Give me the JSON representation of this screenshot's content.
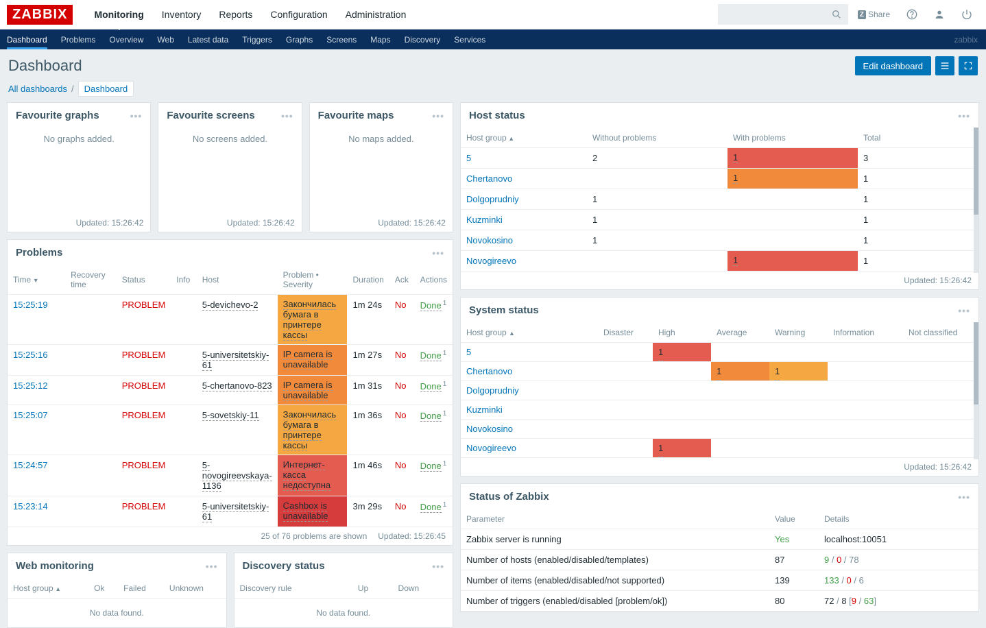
{
  "app": {
    "name": "ZABBIX",
    "user": "zabbix"
  },
  "topnav": [
    "Monitoring",
    "Inventory",
    "Reports",
    "Configuration",
    "Administration"
  ],
  "topnav_active": 0,
  "share": "Share",
  "subnav": [
    "Dashboard",
    "Problems",
    "Overview",
    "Web",
    "Latest data",
    "Triggers",
    "Graphs",
    "Screens",
    "Maps",
    "Discovery",
    "Services"
  ],
  "subnav_active": 0,
  "page": {
    "title": "Dashboard",
    "edit": "Edit dashboard"
  },
  "crumbs": {
    "all": "All dashboards",
    "sep": "/",
    "current": "Dashboard"
  },
  "fav": [
    {
      "title": "Favourite graphs",
      "empty": "No graphs added.",
      "updated": "Updated: 15:26:42"
    },
    {
      "title": "Favourite screens",
      "empty": "No screens added.",
      "updated": "Updated: 15:26:42"
    },
    {
      "title": "Favourite maps",
      "empty": "No maps added.",
      "updated": "Updated: 15:26:42"
    }
  ],
  "problems": {
    "title": "Problems",
    "cols": [
      "Time",
      "Recovery time",
      "Status",
      "Info",
      "Host",
      "Problem • Severity",
      "Duration",
      "Ack",
      "Actions"
    ],
    "rows": [
      {
        "time": "15:25:19",
        "status": "PROBLEM",
        "host": "5-devichevo-2",
        "problem": "Закончилась бумага в принтере кассы",
        "sev": "warn",
        "dur": "1m 24s",
        "ack": "No",
        "act": "Done",
        "sup": "1"
      },
      {
        "time": "15:25:16",
        "status": "PROBLEM",
        "host": "5-universitetskiy-61",
        "problem": "IP camera is unavailable",
        "sev": "avg",
        "dur": "1m 27s",
        "ack": "No",
        "act": "Done",
        "sup": "1"
      },
      {
        "time": "15:25:12",
        "status": "PROBLEM",
        "host": "5-chertanovo-823",
        "problem": "IP camera is unavailable",
        "sev": "avg",
        "dur": "1m 31s",
        "ack": "No",
        "act": "Done",
        "sup": "1"
      },
      {
        "time": "15:25:07",
        "status": "PROBLEM",
        "host": "5-sovetskiy-11",
        "problem": "Закончилась бумага в принтере кассы",
        "sev": "warn",
        "dur": "1m 36s",
        "ack": "No",
        "act": "Done",
        "sup": "1"
      },
      {
        "time": "15:24:57",
        "status": "PROBLEM",
        "host": "5-novogireevskaya-1136",
        "problem": "Интернет-касса недоступна",
        "sev": "high",
        "dur": "1m 46s",
        "ack": "No",
        "act": "Done",
        "sup": "1"
      },
      {
        "time": "15:23:14",
        "status": "PROBLEM",
        "host": "5-universitetskiy-61",
        "problem": "Cashbox is unavailable",
        "sev": "dis",
        "dur": "3m 29s",
        "ack": "No",
        "act": "Done",
        "sup": "1"
      }
    ],
    "summary": "25 of 76 problems are shown",
    "updated": "Updated: 15:26:45"
  },
  "web": {
    "title": "Web monitoring",
    "cols": [
      "Host group",
      "Ok",
      "Failed",
      "Unknown"
    ],
    "nodata": "No data found."
  },
  "discovery": {
    "title": "Discovery status",
    "cols": [
      "Discovery rule",
      "Up",
      "Down"
    ],
    "nodata": "No data found."
  },
  "hoststatus": {
    "title": "Host status",
    "cols": [
      "Host group",
      "Without problems",
      "With problems",
      "Total"
    ],
    "rows": [
      {
        "g": "5",
        "wo": "2",
        "wp": "1",
        "sev": "high",
        "tot": "3"
      },
      {
        "g": "Chertanovo",
        "wo": "",
        "wp": "1",
        "sev": "avg",
        "tot": "1"
      },
      {
        "g": "Dolgoprudniy",
        "wo": "1",
        "wp": "",
        "sev": "",
        "tot": "1"
      },
      {
        "g": "Kuzminki",
        "wo": "1",
        "wp": "",
        "sev": "",
        "tot": "1"
      },
      {
        "g": "Novokosino",
        "wo": "1",
        "wp": "",
        "sev": "",
        "tot": "1"
      },
      {
        "g": "Novogireevo",
        "wo": "",
        "wp": "1",
        "sev": "high",
        "tot": "1"
      }
    ],
    "updated": "Updated: 15:26:42"
  },
  "systemstatus": {
    "title": "System status",
    "cols": [
      "Host group",
      "Disaster",
      "High",
      "Average",
      "Warning",
      "Information",
      "Not classified"
    ],
    "rows": [
      {
        "g": "5",
        "dis": "",
        "high": "1",
        "avg": "",
        "warn": "",
        "info": "",
        "nc": ""
      },
      {
        "g": "Chertanovo",
        "dis": "",
        "high": "",
        "avg": "1",
        "warn": "1",
        "info": "",
        "nc": ""
      },
      {
        "g": "Dolgoprudniy",
        "dis": "",
        "high": "",
        "avg": "",
        "warn": "",
        "info": "",
        "nc": ""
      },
      {
        "g": "Kuzminki",
        "dis": "",
        "high": "",
        "avg": "",
        "warn": "",
        "info": "",
        "nc": ""
      },
      {
        "g": "Novokosino",
        "dis": "",
        "high": "",
        "avg": "",
        "warn": "",
        "info": "",
        "nc": ""
      },
      {
        "g": "Novogireevo",
        "dis": "",
        "high": "1",
        "avg": "",
        "warn": "",
        "info": "",
        "nc": ""
      }
    ],
    "updated": "Updated: 15:26:42"
  },
  "zstatus": {
    "title": "Status of Zabbix",
    "cols": [
      "Parameter",
      "Value",
      "Details"
    ],
    "rows": [
      {
        "p": "Zabbix server is running",
        "v": "Yes",
        "vclass": "green",
        "d": "localhost:10051"
      },
      {
        "p": "Number of hosts (enabled/disabled/templates)",
        "v": "87",
        "d_parts": [
          {
            "t": "9",
            "c": "green"
          },
          {
            "t": " / ",
            "c": "grey"
          },
          {
            "t": "0",
            "c": "red"
          },
          {
            "t": " / ",
            "c": "grey"
          },
          {
            "t": "78",
            "c": "grey"
          }
        ]
      },
      {
        "p": "Number of items (enabled/disabled/not supported)",
        "v": "139",
        "d_parts": [
          {
            "t": "133",
            "c": "green"
          },
          {
            "t": " / ",
            "c": "grey"
          },
          {
            "t": "0",
            "c": "red"
          },
          {
            "t": " / ",
            "c": "grey"
          },
          {
            "t": "6",
            "c": "grey"
          }
        ]
      },
      {
        "p": "Number of triggers (enabled/disabled [problem/ok])",
        "v": "80",
        "d_parts": [
          {
            "t": "72",
            "c": ""
          },
          {
            "t": " / ",
            "c": "grey"
          },
          {
            "t": "8",
            "c": ""
          },
          {
            "t": " [",
            "c": "grey"
          },
          {
            "t": "9",
            "c": "red"
          },
          {
            "t": " / ",
            "c": "grey"
          },
          {
            "t": "63",
            "c": "green"
          },
          {
            "t": "]",
            "c": "grey"
          }
        ]
      }
    ]
  }
}
